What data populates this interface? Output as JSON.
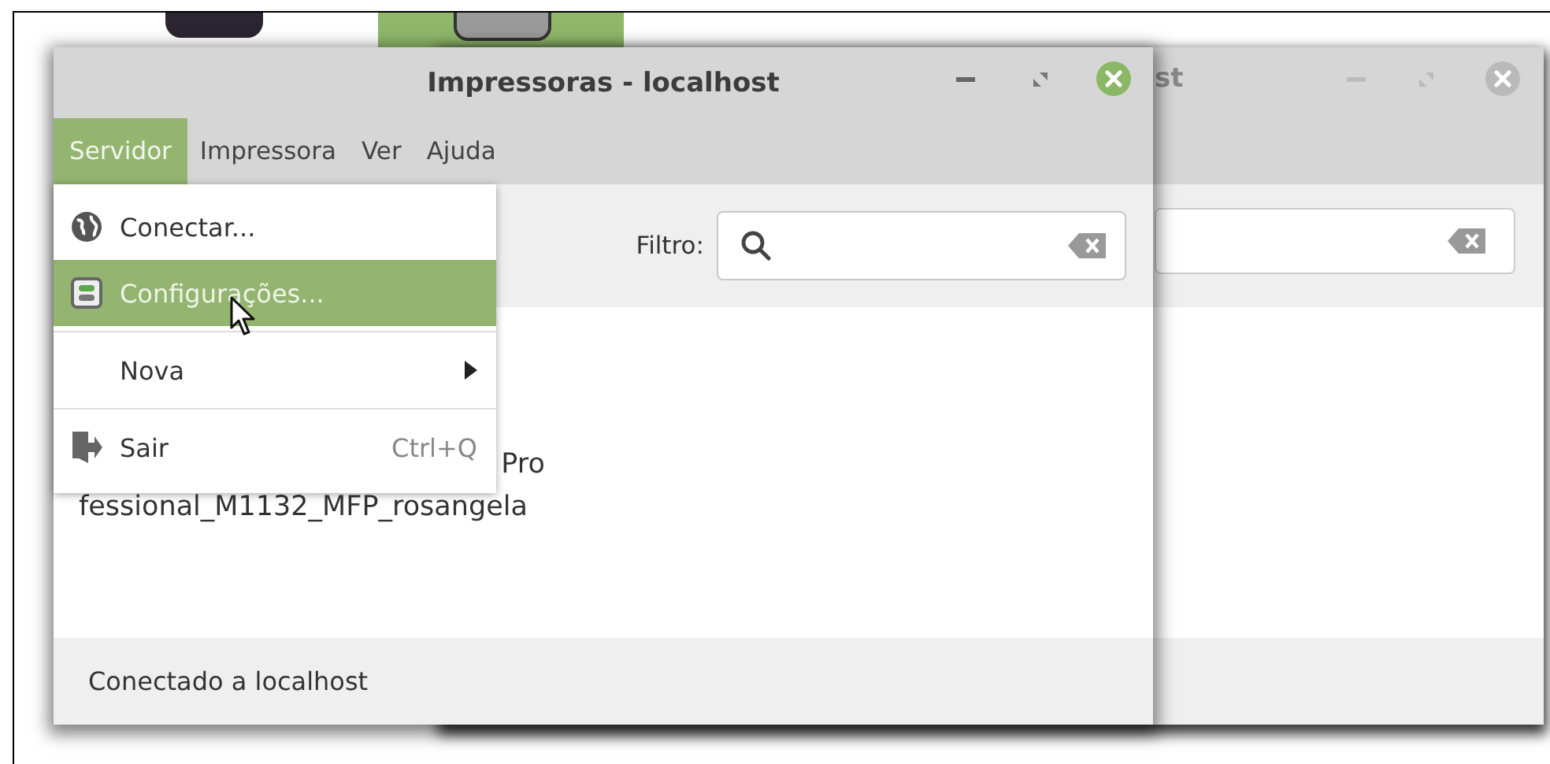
{
  "back_window": {
    "title": "st"
  },
  "window": {
    "title": "Impressoras - localhost",
    "menubar": [
      {
        "label": "Servidor",
        "selected": true
      },
      {
        "label": "Impressora",
        "selected": false
      },
      {
        "label": "Ver",
        "selected": false
      },
      {
        "label": "Ajuda",
        "selected": false
      }
    ],
    "menu": {
      "items": [
        {
          "kind": "item",
          "label": "Conectar...",
          "selected": false,
          "separator_before": false
        },
        {
          "kind": "item",
          "label": "Configurações...",
          "selected": true,
          "separator_before": false
        },
        {
          "kind": "submenu",
          "label": "Nova",
          "selected": false,
          "separator_before": true
        },
        {
          "kind": "item",
          "label": "Sair",
          "shortcut": "Ctrl+Q",
          "selected": false,
          "separator_before": true
        }
      ]
    },
    "toolbar": {
      "filter_label": "Filtro:"
    },
    "printer": {
      "label_lines": [
        "Pro",
        "fessional_M1132_MFP_rosangela"
      ]
    },
    "status": "Conectado a localhost"
  }
}
